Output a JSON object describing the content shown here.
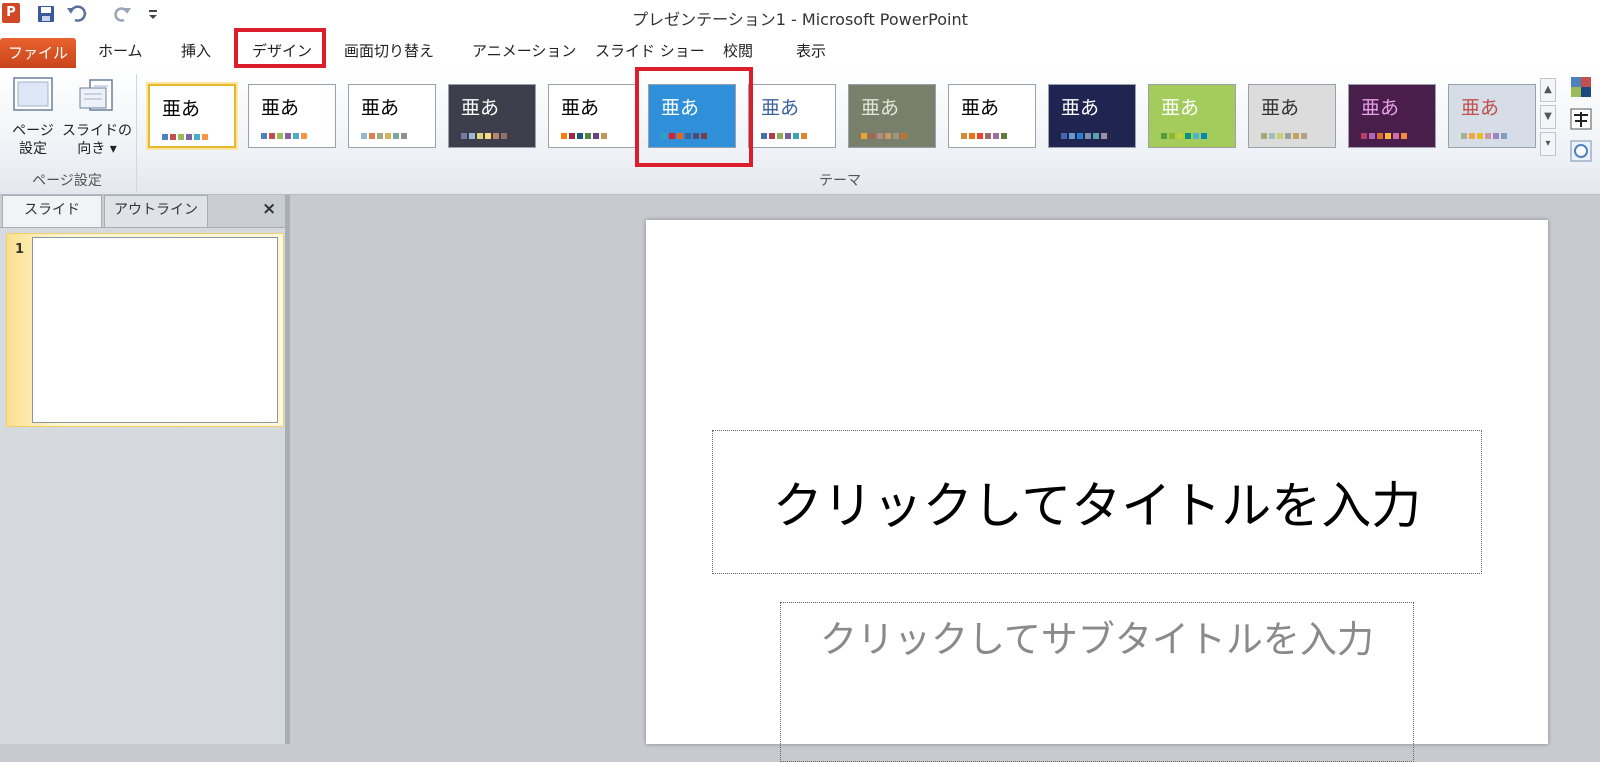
{
  "window": {
    "title": "プレゼンテーション1 - Microsoft PowerPoint",
    "app_icon_letter": "P"
  },
  "qat": {
    "save_icon": "save-icon",
    "undo_icon": "undo-icon",
    "redo_icon": "redo-icon",
    "customize_icon": "customize-icon"
  },
  "tabs": {
    "file": "ファイル",
    "home": "ホーム",
    "insert": "挿入",
    "design": "デザイン",
    "transitions": "画面切り替え",
    "animations": "アニメーション",
    "slideshow": "スライド ショー",
    "review": "校閲",
    "view": "表示"
  },
  "ribbon": {
    "page_setup": {
      "page_setup_label_1": "ページ",
      "page_setup_label_2": "設定",
      "orientation_label_1": "スライドの",
      "orientation_label_2": "向き ▾",
      "group_label": "ページ設定"
    },
    "themes": {
      "group_label": "テーマ",
      "glyph": "亜あ",
      "selected_index": 0,
      "highlighted_index": 5,
      "items": [
        {
          "bg": "#ffffff",
          "fg": "#000000",
          "swatches": [
            "#4f81bd",
            "#c0504d",
            "#9bbb59",
            "#8064a2",
            "#4bacc6",
            "#f79646"
          ]
        },
        {
          "bg": "#ffffff",
          "fg": "#000000",
          "swatches": [
            "#4f81bd",
            "#c0504d",
            "#9bbb59",
            "#8064a2",
            "#4bacc6",
            "#f79646"
          ]
        },
        {
          "bg": "#ffffff",
          "fg": "#000000",
          "swatches": [
            "#94b6d2",
            "#dd8047",
            "#a5ab81",
            "#d8b25c",
            "#7ba79d",
            "#968c8c"
          ]
        },
        {
          "bg": "#3d3e4c",
          "fg": "#ffffff",
          "swatches": [
            "#727ca3",
            "#9fb8cd",
            "#d2da7a",
            "#fada7a",
            "#b88472",
            "#8e736a"
          ]
        },
        {
          "bg": "#ffffff",
          "fg": "#000000",
          "swatches": [
            "#f07f09",
            "#9f2936",
            "#1b587c",
            "#4e8542",
            "#604878",
            "#c19859"
          ]
        },
        {
          "bg": "#2f8fd8",
          "fg": "#ffffff",
          "swatches": [
            "#2da2bf",
            "#da1f28",
            "#eb641b",
            "#39639d",
            "#474b78",
            "#7d3c4a"
          ]
        },
        {
          "bg": "#ffffff",
          "fg": "#3b62a0",
          "swatches": [
            "#3e6fb0",
            "#b13f49",
            "#8eaf55",
            "#7a5e9c",
            "#3fa0b9",
            "#e08434"
          ]
        },
        {
          "bg": "#78806c",
          "fg": "#e6e6d8",
          "swatches": [
            "#f0a22e",
            "#a5644e",
            "#b58b80",
            "#c3986d",
            "#a19574",
            "#c17529"
          ]
        },
        {
          "bg": "#ffffff",
          "fg": "#000000",
          "swatches": [
            "#ce8d3e",
            "#ec7016",
            "#e64823",
            "#9c6a6a",
            "#9b6fa5",
            "#5a7d3c"
          ]
        },
        {
          "bg": "#1f2451",
          "fg": "#ffffff",
          "swatches": [
            "#4a66ac",
            "#629dd1",
            "#297fd5",
            "#7f8fa9",
            "#5aa2ae",
            "#9d90a0"
          ]
        },
        {
          "bg": "#a4cc5c",
          "fg": "#ffffff",
          "swatches": [
            "#549e39",
            "#8ab833",
            "#c0cf3a",
            "#029676",
            "#4ab5c4",
            "#0989b1"
          ]
        },
        {
          "bg": "#dcdcdc",
          "fg": "#333333",
          "swatches": [
            "#a9a57c",
            "#9cbebd",
            "#d2cb6c",
            "#95a39d",
            "#c89f5d",
            "#b1a089"
          ]
        },
        {
          "bg": "#4a1e4a",
          "fg": "#e8a0e8",
          "swatches": [
            "#b83d68",
            "#ac66bb",
            "#de6c36",
            "#f9b639",
            "#cf6da4",
            "#fa8d3d"
          ]
        },
        {
          "bg": "#d6dde6",
          "fg": "#c0504d",
          "swatches": [
            "#a5b592",
            "#f3a447",
            "#e7bc29",
            "#d092a7",
            "#9c85c0",
            "#809ec2"
          ]
        }
      ]
    }
  },
  "panel": {
    "tab_slide": "スライド",
    "tab_outline": "アウトライン",
    "close_glyph": "×",
    "slide_number": "1"
  },
  "slide": {
    "title_placeholder": "クリックしてタイトルを入力",
    "subtitle_placeholder": "クリックしてサブタイトルを入力"
  }
}
